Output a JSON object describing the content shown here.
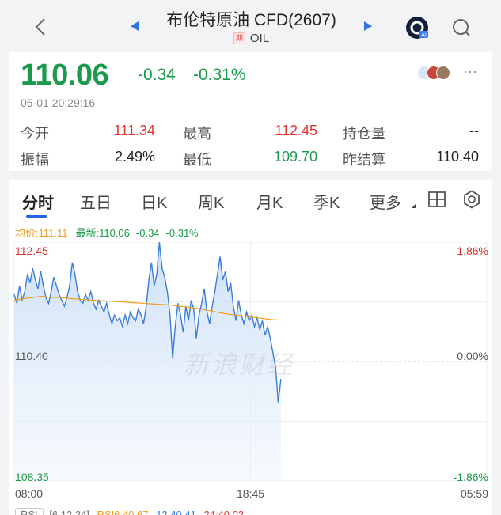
{
  "header": {
    "title": "布伦特原油 CFD(2607)",
    "period_tag": "期",
    "ticker": "OIL"
  },
  "quote": {
    "price": "110.06",
    "change": "-0.34",
    "change_pct": "-0.31%",
    "time": "05-01 20:29:16",
    "stats": {
      "open_label": "今开",
      "open": "111.34",
      "high_label": "最高",
      "high": "112.45",
      "oi_label": "持仓量",
      "oi": "--",
      "amp_label": "振幅",
      "amp": "2.49%",
      "low_label": "最低",
      "low": "109.70",
      "settle_label": "昨结算",
      "settle": "110.40"
    }
  },
  "tabs": {
    "items": [
      "分时",
      "五日",
      "日K",
      "周K",
      "月K",
      "季K",
      "更多"
    ],
    "active_index": 0
  },
  "chart_legend": {
    "avg": "均价:111.11",
    "last": "最新:110.06",
    "chg": "-0.34",
    "pct": "-0.31%"
  },
  "chart_data": {
    "type": "line",
    "x_tick_labels": [
      "08:00",
      "18:45",
      "05:59"
    ],
    "y_left_labels": [
      "112.45",
      "110.40",
      "108.35"
    ],
    "y_right_labels": [
      "1.86%",
      "0.00%",
      "-1.86%"
    ],
    "ylim": [
      108.35,
      112.45
    ],
    "reference": 110.4,
    "series": [
      {
        "values": [
          111.55,
          111.4,
          111.7,
          111.45,
          111.6,
          111.9,
          111.75,
          112.0,
          111.8,
          111.65,
          111.95,
          111.7,
          111.5,
          111.4,
          111.6,
          111.85,
          111.7,
          111.55,
          111.45,
          111.35,
          111.5,
          111.7,
          112.1,
          111.9,
          111.6,
          111.45,
          111.4,
          111.55,
          111.45,
          111.6,
          111.4,
          111.3,
          111.45,
          111.35,
          111.25,
          111.4,
          111.2,
          111.05,
          111.2,
          111.1,
          111.15,
          111.0,
          111.2,
          111.05,
          111.25,
          111.15,
          111.1,
          111.3,
          111.2,
          111.05,
          111.35,
          111.8,
          112.1,
          111.7,
          111.9,
          112.45,
          112.0,
          111.85,
          111.6,
          111.2,
          110.45,
          111.0,
          111.4,
          111.2,
          110.9,
          111.35,
          111.1,
          111.45,
          111.3,
          110.8,
          111.2,
          111.4,
          111.65,
          111.25,
          111.05,
          111.35,
          111.6,
          111.9,
          112.2,
          111.8,
          111.95,
          111.6,
          111.75,
          111.35,
          111.1,
          111.45,
          111.2,
          111.05,
          111.25,
          111.1,
          111.2,
          111.0,
          111.15,
          110.95,
          111.1,
          110.85,
          111.0,
          110.8,
          110.55,
          110.3,
          109.7,
          110.1
        ]
      },
      {
        "name": "均价",
        "values": [
          111.45,
          111.48,
          111.5,
          111.52,
          111.5,
          111.5,
          111.48,
          111.47,
          111.46,
          111.45,
          111.44,
          111.43,
          111.42,
          111.41,
          111.4,
          111.39,
          111.38,
          111.37,
          111.35,
          111.33,
          111.31,
          111.28,
          111.25,
          111.22,
          111.2,
          111.18,
          111.16,
          111.14,
          111.12,
          111.11
        ]
      }
    ]
  },
  "rsi": {
    "label": "RSI",
    "params": "[6,12,24]",
    "rsi6": "RSI6:40.67",
    "rsi12": "12:40.41",
    "rsi24": "24:40.02"
  },
  "watermark": "新浪财经",
  "colors": {
    "up": "#e0342f",
    "down": "#1a9a4a",
    "line": "#3b7ddb",
    "avg": "#f0a01e",
    "accent": "#2563eb"
  }
}
